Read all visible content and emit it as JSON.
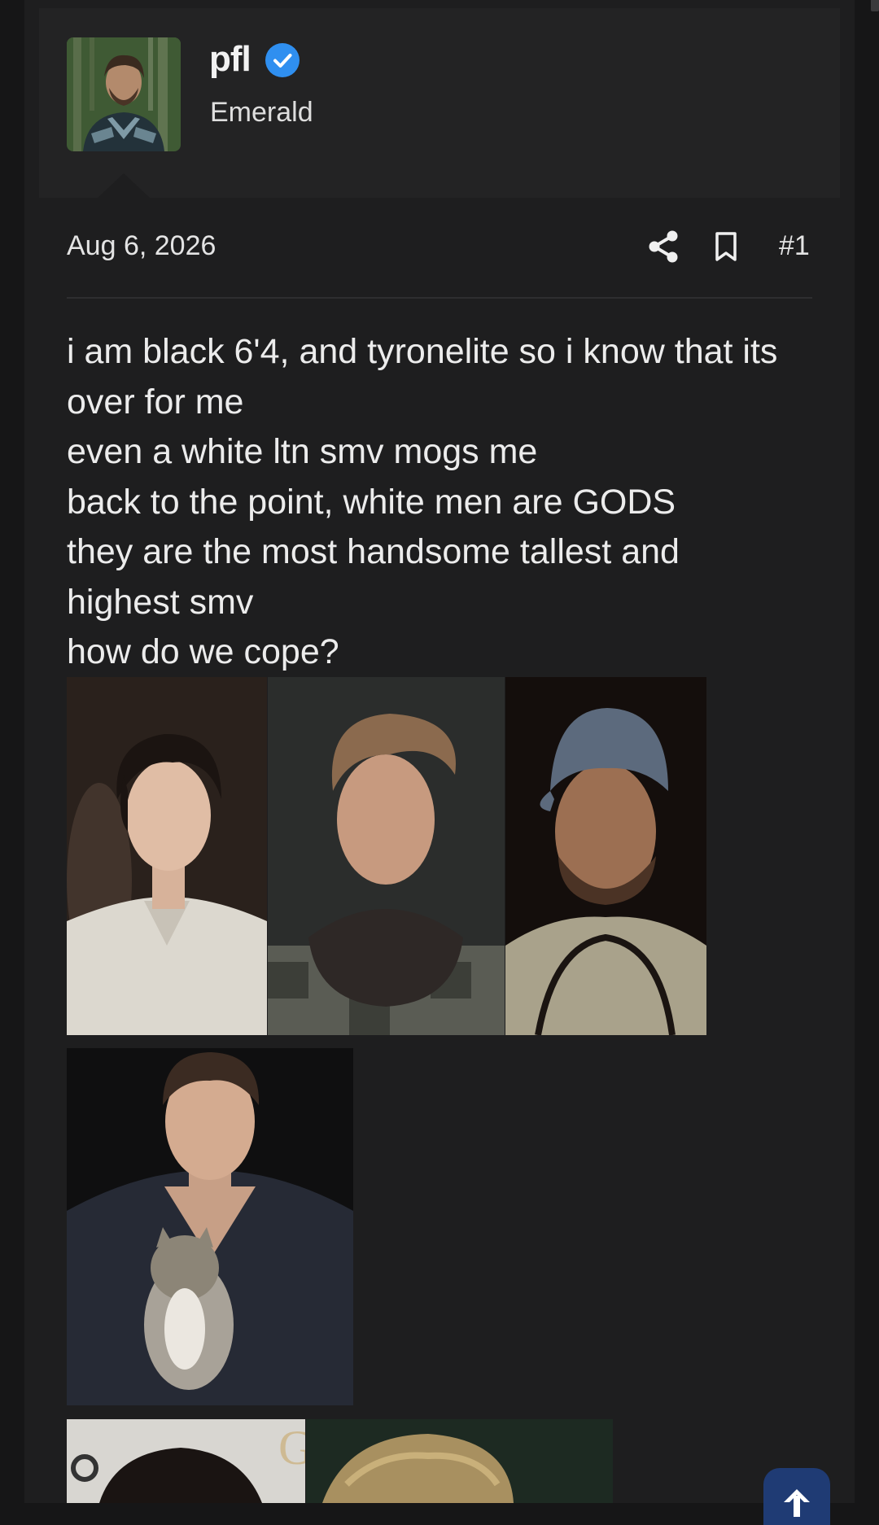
{
  "post": {
    "author": {
      "username": "pfl",
      "user_title": "Emerald",
      "avatar_icon": "avatar-image",
      "verified_icon": "verified-badge-icon",
      "verified_color": "#2f8ff0"
    },
    "date": "Aug 6, 2026",
    "actions": {
      "share_icon": "share-icon",
      "bookmark_icon": "bookmark-icon",
      "post_number": "#1"
    },
    "body_lines": [
      "i am black 6'4, and tyronelite so i know that its",
      "over for me",
      "even a white ltn smv mogs me",
      "back to the point, white men are GODS",
      "they are the most handsome tallest and",
      "highest smv",
      "how do we cope?"
    ],
    "attachments": [
      {
        "name": "photo-young-man-white-shirt"
      },
      {
        "name": "photo-man-knit-scarf"
      },
      {
        "name": "photo-man-denim-cap"
      },
      {
        "name": "photo-man-leather-jacket-with-cat"
      },
      {
        "name": "photo-man-dark-curly-hair"
      },
      {
        "name": "photo-man-blond-hair"
      }
    ]
  },
  "ui": {
    "scroll_top_icon": "arrow-up-icon",
    "scroll_top_color": "#1f3b74"
  }
}
